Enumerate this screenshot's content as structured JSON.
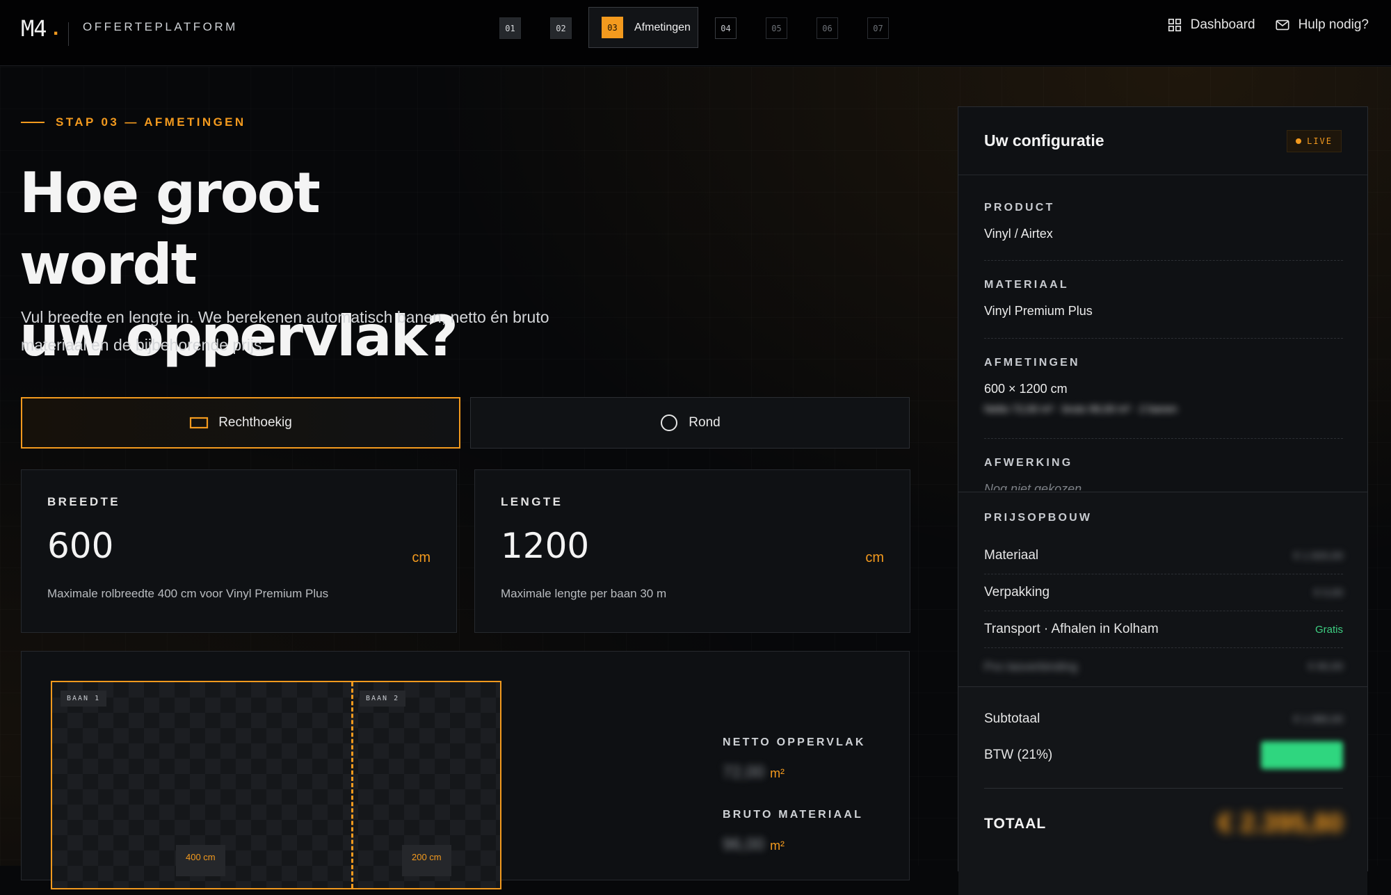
{
  "brand": {
    "logo": "M4",
    "logo_dot": ".",
    "platform": "OFFERTEPLATFORM"
  },
  "steps": {
    "s1": "01",
    "s2": "02",
    "s3": "03",
    "s3_label": "Afmetingen",
    "s4": "04",
    "s5": "05",
    "s6": "06",
    "s7": "07"
  },
  "nav": {
    "dashboard": "Dashboard",
    "help": "Hulp nodig?"
  },
  "hero": {
    "eyebrow": "STAP 03 — AFMETINGEN",
    "headline_line1": "Hoe groot wordt",
    "headline_line2": "uw oppervlak?",
    "lead": "Vul breedte en lengte in. We berekenen automatisch banen, netto én bruto materiaal en de bijbehorende prijs."
  },
  "shapes": {
    "rect": "Rechthoekig",
    "round": "Rond"
  },
  "dimensions": {
    "width_label": "BREEDTE",
    "width_value": "600",
    "width_unit": "cm",
    "width_help": "Maximale rolbreedte 400 cm voor Vinyl Premium Plus",
    "length_label": "LENGTE",
    "length_value": "1200",
    "length_unit": "cm",
    "length_help": "Maximale lengte per baan 30 m"
  },
  "preview": {
    "baan1": "BAAN 1",
    "baan2": "BAAN 2",
    "baan1_width": "400 cm",
    "baan2_width": "200 cm",
    "netto_label": "NETTO OPPERVLAK",
    "netto_value": "72,00",
    "netto_unit": "m²",
    "bruto_label": "BRUTO MATERIAAL",
    "bruto_value": "96,00",
    "bruto_unit": "m²"
  },
  "config": {
    "title": "Uw configuratie",
    "live": "LIVE",
    "product_label": "PRODUCT",
    "product_value": "Vinyl / Airtex",
    "material_label": "MATERIAAL",
    "material_value": "Vinyl Premium Plus",
    "dimensions_label": "AFMETINGEN",
    "dimensions_value": "600 × 1200 cm",
    "dimensions_detail": "Netto 72,00 m² · bruto 96,00 m² · 2 banen",
    "finish_label": "AFWERKING",
    "finish_value": "Nog niet gekozen"
  },
  "pricing": {
    "label": "PRIJSOPBOUW",
    "material": "Materiaal",
    "material_value": "€ 1.920,00",
    "packaging": "Verpakking",
    "packaging_value": "€ 0,00",
    "transport": "Transport · Afhalen in Kolham",
    "transport_value": "Gratis",
    "extra": "Pvc-lasverbinding",
    "extra_value": "€ 60,00",
    "subtotal": "Subtotaal",
    "subtotal_value": "€ 1.980,00",
    "vat": "BTW (21%)",
    "total": "TOTAAL",
    "total_value": "€ 2.395,80"
  },
  "colors": {
    "accent": "#f39a1e",
    "success": "#3ecf82",
    "background": "#07080a"
  }
}
